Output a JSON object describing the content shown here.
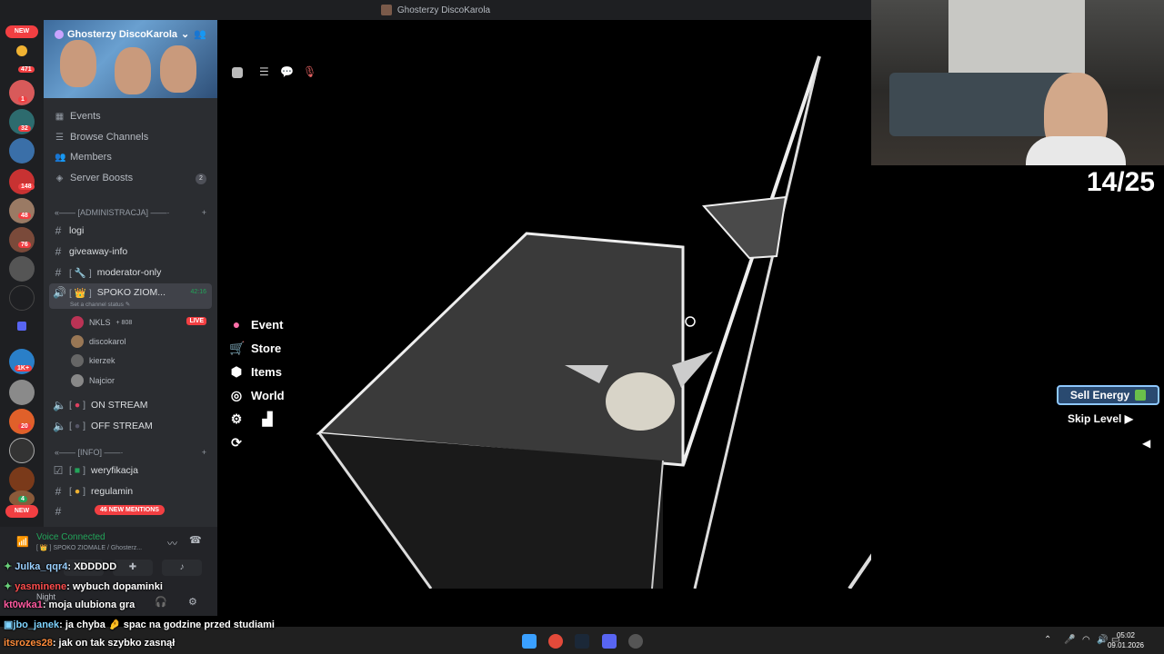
{
  "window": {
    "title": "Ghosterzy DiscoKarola"
  },
  "guilds": {
    "new_top": "NEW",
    "new_bottom": "NEW",
    "badges": [
      "471",
      "1",
      "32",
      "148",
      "48",
      "76",
      "1K+",
      "20",
      "4"
    ]
  },
  "server": {
    "name": "Ghosterzy DiscoKarola",
    "nav": [
      {
        "label": "Events",
        "icon": "calendar-icon"
      },
      {
        "label": "Browse Channels",
        "icon": "browse-icon"
      },
      {
        "label": "Members",
        "icon": "members-icon"
      },
      {
        "label": "Server Boosts",
        "icon": "boost-icon",
        "count": "2"
      }
    ]
  },
  "channels": {
    "cat_admin": "[ADMINISTRACJA]",
    "logi": "logi",
    "giveaway": "giveaway-info",
    "moderator": "moderator-only",
    "moderator_tag": "[ 🔧 ]",
    "spoko": "SPOKO ZIOM...",
    "spoko_tag": "[ 👑 ]",
    "spoko_time": "42:16",
    "spoko_status": "Set a channel status ✎",
    "users": [
      {
        "name": "NKLS",
        "extra": "+ 808",
        "live": "LIVE"
      },
      {
        "name": "discokarol"
      },
      {
        "name": "kierzek"
      },
      {
        "name": "Najcior"
      }
    ],
    "on_stream": "ON STREAM",
    "off_stream": "OFF STREAM",
    "cat_info": "[INFO]",
    "weryfikacja": "weryfikacja",
    "regulamin": "regulamin",
    "mentions": "46 NEW MENTIONS"
  },
  "voice": {
    "title": "Voice Connected",
    "subtitle": "[ 👑 ] SPOKO ZIOMALE / Ghosterz...",
    "user_status": "Night"
  },
  "game": {
    "menu": [
      {
        "label": "Event",
        "icon": "event-icon"
      },
      {
        "label": "Store",
        "icon": "cart-icon"
      },
      {
        "label": "Items",
        "icon": "cube-icon"
      },
      {
        "label": "World",
        "icon": "world-icon"
      }
    ],
    "sell_energy": "Sell Energy",
    "skip_level": "Skip Level"
  },
  "counter": "14/25",
  "chat": [
    {
      "user": "Julka_qqr4",
      "text": ": XDDDDD",
      "color": "#9ad0ff"
    },
    {
      "user": "yasminene",
      "text": ": wybuch dopaminki",
      "color": "#ff4d4d"
    },
    {
      "user": "kt0wka1",
      "text": ": moja ulubiona gra",
      "color": "#ff5aa0"
    },
    {
      "user": "jbo_janek",
      "text": ": ja chyba  🤌  spac na godzine przed studiami",
      "color": "#7fd4ff"
    },
    {
      "user": "itsrozes28",
      "text": ": jak on tak szybko zasnął",
      "color": "#ff8c3a"
    }
  ],
  "taskbar": {
    "time": "05:02",
    "date": "09.01.2026"
  }
}
